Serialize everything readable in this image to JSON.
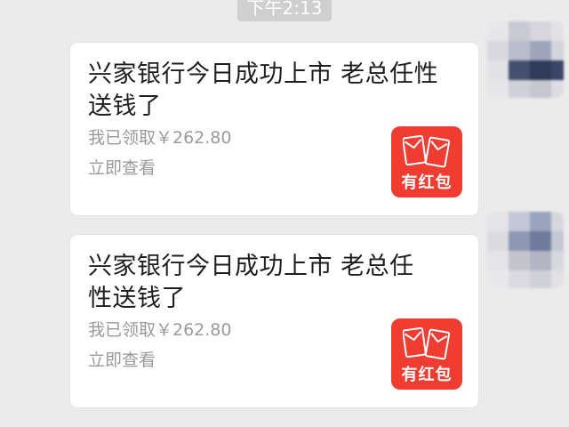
{
  "timestamp": "下午2:13",
  "messages": [
    {
      "title": "兴家银行今日成功上市  老总任性送钱了",
      "subtitle": "我已领取￥262.80",
      "action": "立即查看",
      "badge": "有红包"
    },
    {
      "title": "兴家银行今日成功上市  老总任性送钱了",
      "subtitle": "我已领取￥262.80",
      "action": "立即查看",
      "badge": "有红包"
    }
  ],
  "colors": {
    "background": "#ebebeb",
    "card": "#ffffff",
    "red_packet": "#ef3d32",
    "timestamp_bg": "#cfcfcf"
  },
  "icons": {
    "red_packet": "red-packet-icon",
    "avatar": "blurred-avatar"
  }
}
